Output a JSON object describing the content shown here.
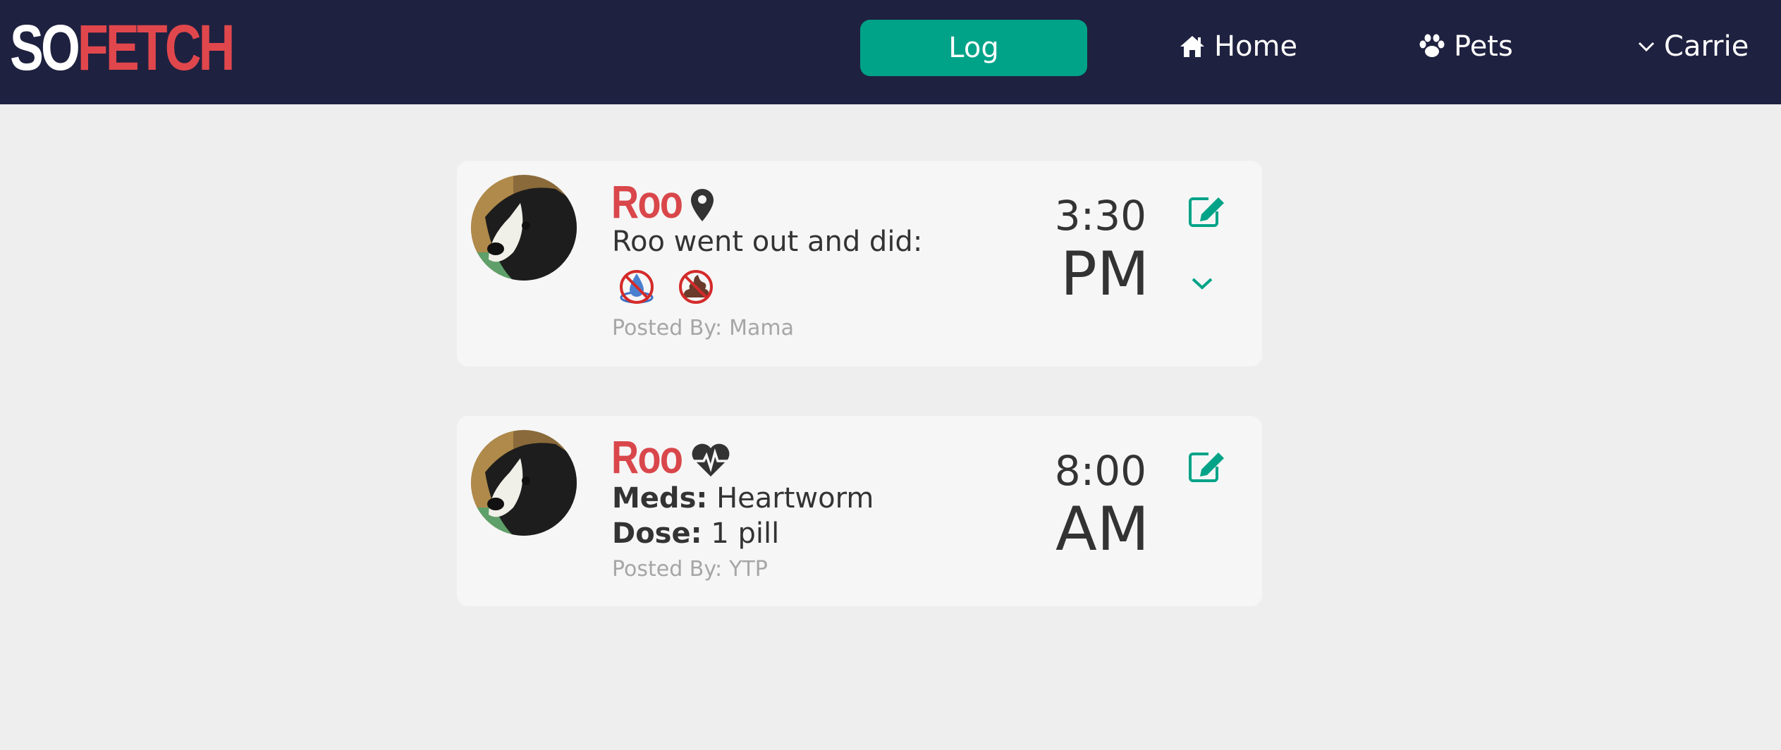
{
  "brand": {
    "part1": "SO",
    "part2": "FETCH"
  },
  "nav": {
    "log_label": "Log",
    "home_label": "Home",
    "pets_label": "Pets",
    "user_label": "Carrie"
  },
  "colors": {
    "navbar": "#1f2140",
    "accent": "#00a388",
    "brand_red": "#e0474c",
    "background": "#eeeeee",
    "card": "#f6f6f6"
  },
  "entries": [
    {
      "pet_name": "Roo",
      "type_icon": "map-marker-icon",
      "description": "Roo went out and did:",
      "activity_icons": [
        "no-pee-icon",
        "no-poop-icon"
      ],
      "posted_by_label": "Posted By:",
      "posted_by": "Mama",
      "time": "3:30",
      "ampm": "PM"
    },
    {
      "pet_name": "Roo",
      "type_icon": "heartbeat-icon",
      "meds_label": "Meds:",
      "meds_value": "Heartworm",
      "dose_label": "Dose:",
      "dose_value": "1 pill",
      "posted_by_label": "Posted By:",
      "posted_by": "YTP",
      "time": "8:00",
      "ampm": "AM"
    }
  ]
}
